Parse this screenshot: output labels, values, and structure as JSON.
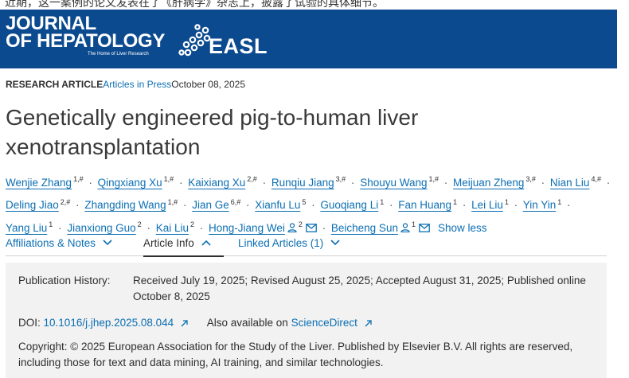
{
  "top_strip_text": "近期，这一案例的论文发表在了《肝病学》杂志上，披露了试验的具体细节。",
  "banner": {
    "journal_line1": "JOURNAL",
    "journal_line2": "OF HEPATOLOGY",
    "tagline": "The Home of Liver Research",
    "easl_text": "EASL"
  },
  "meta": {
    "type": "RESEARCH ARTICLE",
    "section_link": "Articles in Press",
    "date": "October 08, 2025"
  },
  "title": "Genetically engineered pig-to-human liver xenotransplantation",
  "authors": [
    {
      "name": "Wenjie Zhang",
      "sup": "1,#"
    },
    {
      "name": "Qingxiang Xu",
      "sup": "1,#"
    },
    {
      "name": "Kaixiang Xu",
      "sup": "2,#"
    },
    {
      "name": "Runqiu Jiang",
      "sup": "3,#"
    },
    {
      "name": "Shouyu Wang",
      "sup": "1,#"
    },
    {
      "name": "Meijuan Zheng",
      "sup": "3,#"
    },
    {
      "name": "Nian Liu",
      "sup": "4,#"
    },
    {
      "name": "Deling Jiao",
      "sup": "2,#"
    },
    {
      "name": "Zhangding Wang",
      "sup": "1,#"
    },
    {
      "name": "Jian Ge",
      "sup": "6,#"
    },
    {
      "name": "Xianfu Lu",
      "sup": "5"
    },
    {
      "name": "Guoqiang Li",
      "sup": "1"
    },
    {
      "name": "Fan Huang",
      "sup": "1"
    },
    {
      "name": "Lei Liu",
      "sup": "1"
    },
    {
      "name": "Yin Yin",
      "sup": "1"
    },
    {
      "name": "Yang Liu",
      "sup": "1"
    },
    {
      "name": "Jianxiong Guo",
      "sup": "2"
    },
    {
      "name": "Kai Liu",
      "sup": "2"
    },
    {
      "name": "Hong-Jiang Wei",
      "sup": "2"
    },
    {
      "name": "Beicheng Sun",
      "sup": "1"
    }
  ],
  "show_less": "Show less",
  "separator": "·",
  "tabs": {
    "affiliations": "Affiliations & Notes",
    "article_info": "Article Info",
    "linked": "Linked Articles (1)"
  },
  "info": {
    "history_label": "Publication History:",
    "history_value": "Received July 19, 2025; Revised August 25, 2025; Accepted August 31, 2025; Published online October 8, 2025",
    "doi_label": "DOI:",
    "doi_value": "10.1016/j.jhep.2025.08.044",
    "available_label": "Also available on",
    "available_link": "ScienceDirect",
    "copyright": "Copyright: © 2025 European Association for the Study of the Liver. Published by Elsevier B.V. All rights are reserved, including those for text and data mining, AI training, and similar technologies."
  },
  "colors": {
    "banner": "#0c4a8f",
    "link": "#0c6fb3",
    "panel": "#f2f2f2"
  }
}
